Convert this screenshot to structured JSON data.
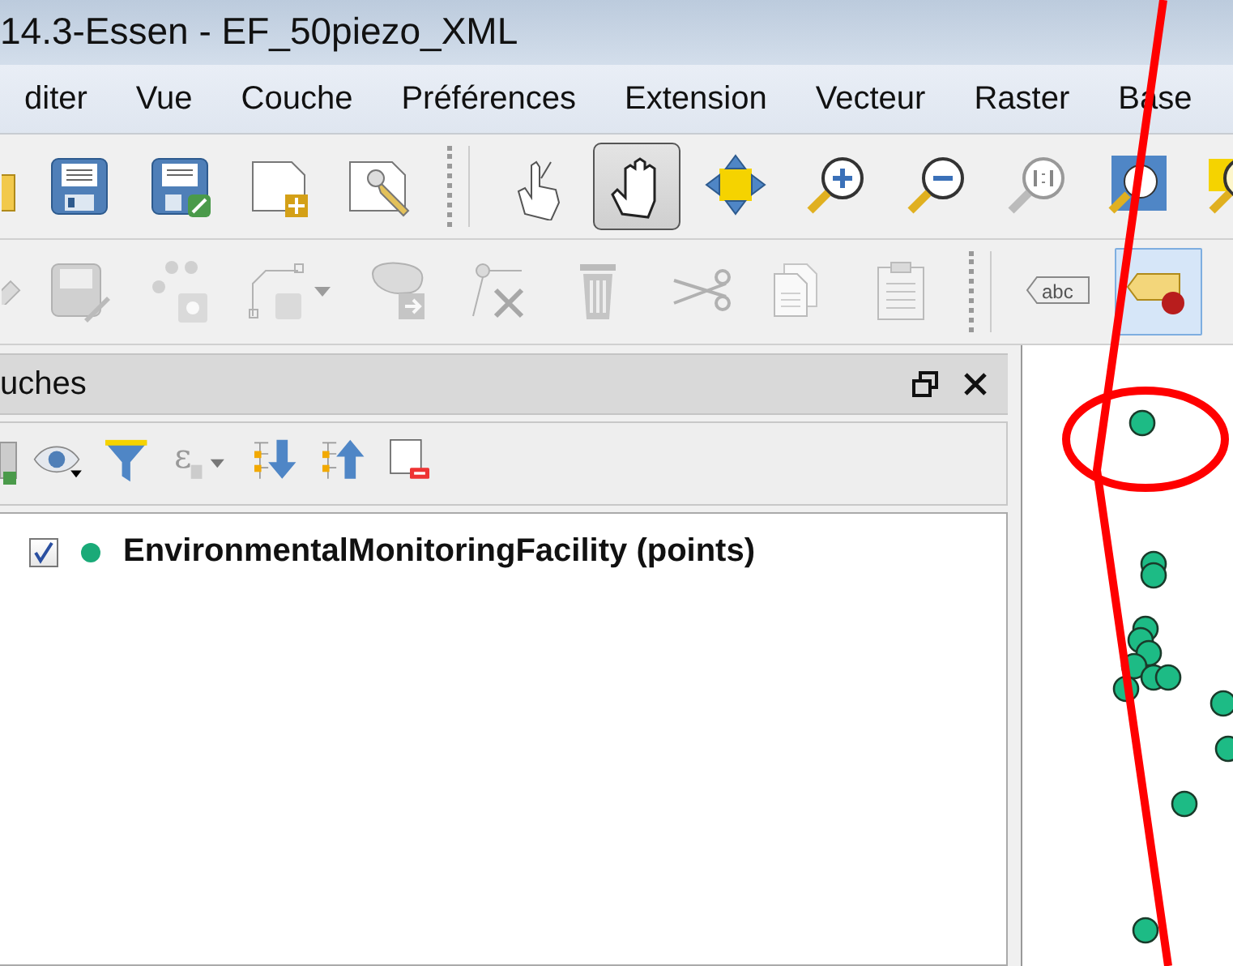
{
  "window": {
    "title": "14.3-Essen - EF_50piezo_XML"
  },
  "menu": [
    "diter",
    "Vue",
    "Couche",
    "Préférences",
    "Extension",
    "Vecteur",
    "Raster",
    "Base"
  ],
  "toolbars": [
    [
      {
        "kind": "folder",
        "active": false,
        "disabled": false
      },
      {
        "kind": "save",
        "active": false,
        "disabled": false
      },
      {
        "kind": "save-as",
        "active": false,
        "disabled": false
      },
      {
        "kind": "new-page",
        "active": false,
        "disabled": false
      },
      {
        "kind": "page-wrench",
        "active": false,
        "disabled": false
      },
      {
        "kind": "separator"
      },
      {
        "kind": "touch",
        "active": false,
        "disabled": false
      },
      {
        "kind": "pan",
        "active": true,
        "disabled": false
      },
      {
        "kind": "pan-arrows",
        "active": false,
        "disabled": false
      },
      {
        "kind": "zoom-in",
        "active": false,
        "disabled": false
      },
      {
        "kind": "zoom-out",
        "active": false,
        "disabled": false
      },
      {
        "kind": "zoom-native",
        "active": false,
        "disabled": false
      },
      {
        "kind": "zoom-full",
        "active": false,
        "disabled": false
      },
      {
        "kind": "zoom-layer",
        "active": false,
        "disabled": false
      }
    ],
    [
      {
        "kind": "pencil",
        "active": false,
        "disabled": true
      },
      {
        "kind": "save-edit",
        "active": false,
        "disabled": true
      },
      {
        "kind": "add-point",
        "active": false,
        "disabled": true
      },
      {
        "kind": "add-line",
        "active": false,
        "disabled": true
      },
      {
        "kind": "move-feature",
        "active": false,
        "disabled": true
      },
      {
        "kind": "node-tool",
        "active": false,
        "disabled": true
      },
      {
        "kind": "delete",
        "active": false,
        "disabled": true
      },
      {
        "kind": "cut",
        "active": false,
        "disabled": true
      },
      {
        "kind": "copy",
        "active": false,
        "disabled": true
      },
      {
        "kind": "paste",
        "active": false,
        "disabled": true
      },
      {
        "kind": "separator"
      },
      {
        "kind": "label",
        "active": false,
        "disabled": false,
        "text": "abc"
      },
      {
        "kind": "label-pin",
        "active": true,
        "disabled": false
      }
    ]
  ],
  "layers_panel": {
    "title": "uches",
    "tools": [
      {
        "kind": "add-group"
      },
      {
        "kind": "eye"
      },
      {
        "kind": "filter"
      },
      {
        "kind": "expression",
        "symbol": "ε"
      },
      {
        "kind": "expand"
      },
      {
        "kind": "collapse"
      },
      {
        "kind": "remove"
      }
    ],
    "layers": [
      {
        "name": "EnvironmentalMonitoringFacility (points)",
        "visible": true,
        "color": "#1aaa78"
      }
    ]
  }
}
